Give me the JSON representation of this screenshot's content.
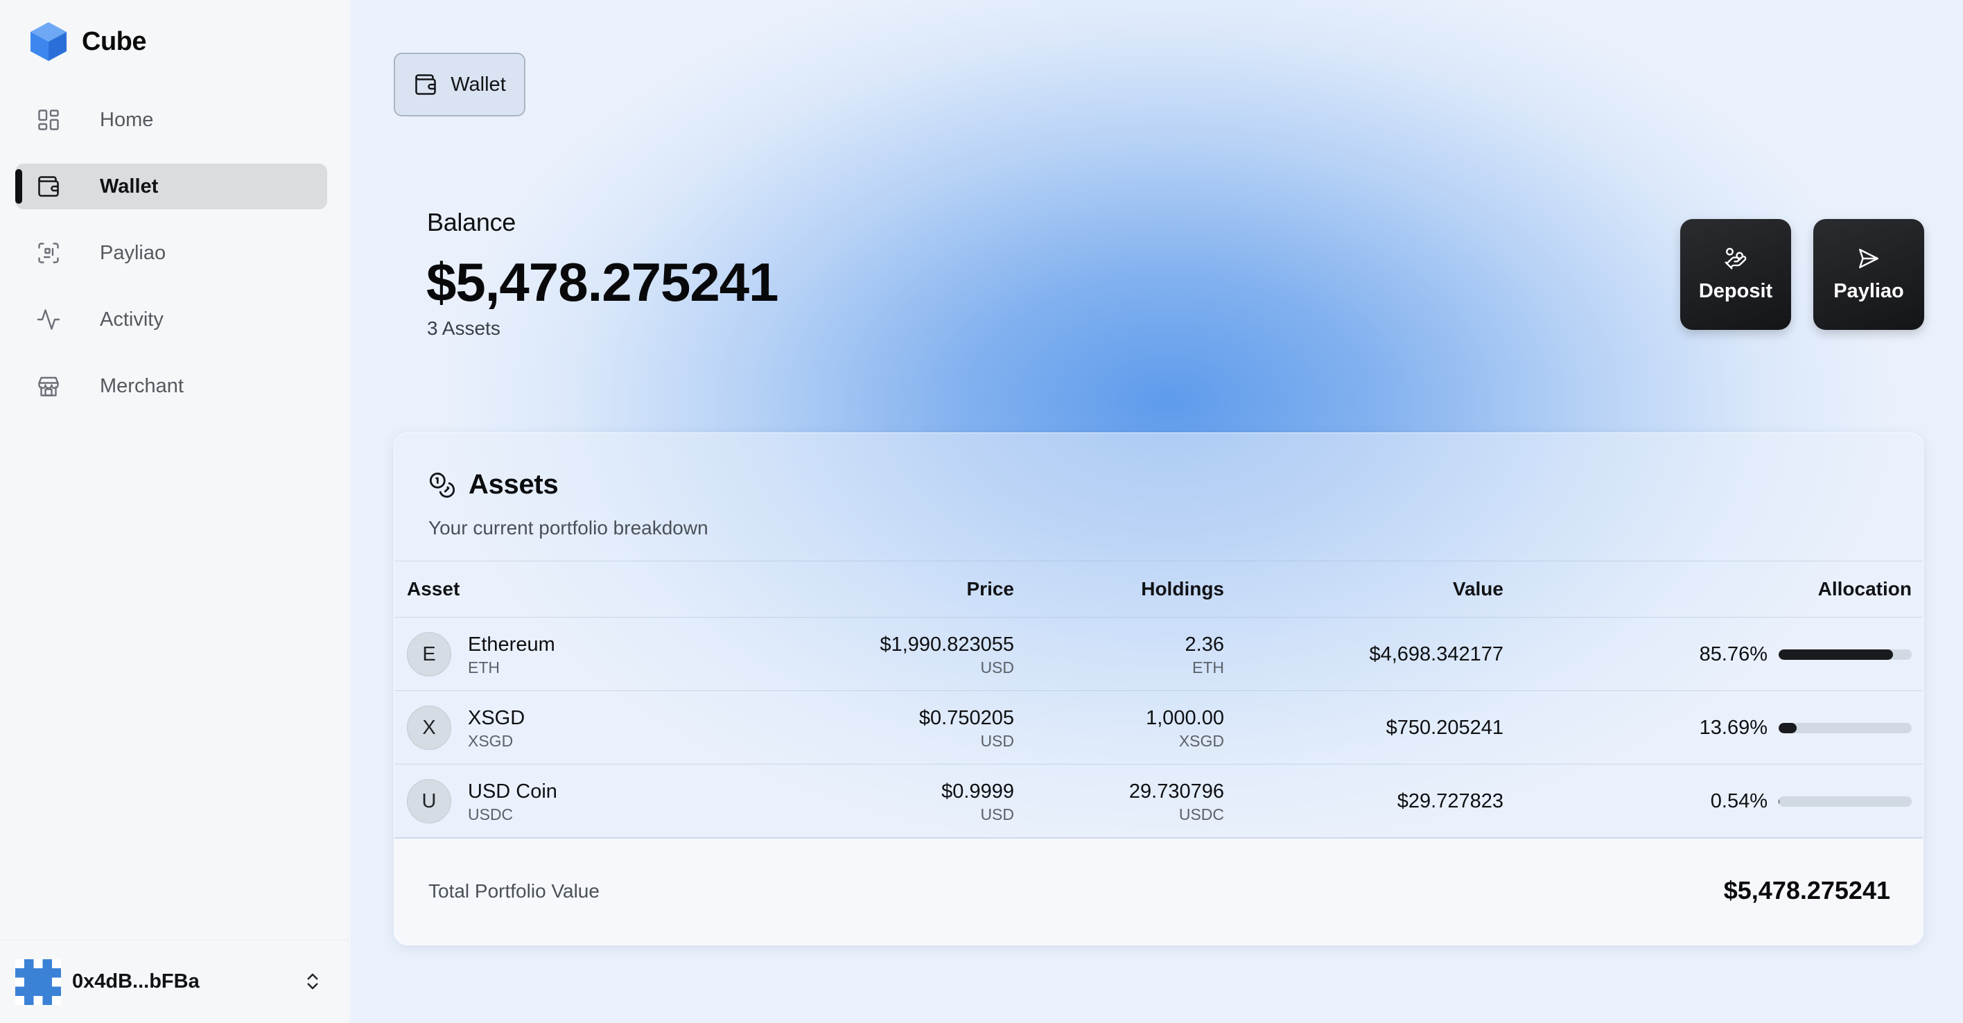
{
  "brand": {
    "name": "Cube",
    "logo_icon": "cube-logo-icon",
    "accent": "#3b82f6"
  },
  "sidebar": {
    "items": [
      {
        "label": "Home",
        "icon": "grid-icon",
        "active": false
      },
      {
        "label": "Wallet",
        "icon": "wallet-icon",
        "active": true
      },
      {
        "label": "Payliao",
        "icon": "scan-icon",
        "active": false
      },
      {
        "label": "Activity",
        "icon": "activity-icon",
        "active": false
      },
      {
        "label": "Merchant",
        "icon": "store-icon",
        "active": false
      }
    ],
    "account": {
      "address": "0x4dB...bFBa",
      "toggle_icon": "chevrons-up-down-icon"
    }
  },
  "header": {
    "tab_label": "Wallet"
  },
  "balance": {
    "label": "Balance",
    "amount": "$5,478.275241",
    "assets_count": "3 Assets"
  },
  "actions": {
    "deposit_label": "Deposit",
    "payliao_label": "Payliao"
  },
  "assets": {
    "title": "Assets",
    "description": "Your current portfolio breakdown",
    "columns": {
      "asset": "Asset",
      "price": "Price",
      "holdings": "Holdings",
      "value": "Value",
      "allocation": "Allocation"
    },
    "rows": [
      {
        "initial": "E",
        "name": "Ethereum",
        "symbol": "ETH",
        "price": "$1,990.823055",
        "price_unit": "USD",
        "holdings": "2.36",
        "holdings_unit": "ETH",
        "value": "$4,698.342177",
        "allocation": "85.76%",
        "allocation_fraction": 0.8576
      },
      {
        "initial": "X",
        "name": "XSGD",
        "symbol": "XSGD",
        "price": "$0.750205",
        "price_unit": "USD",
        "holdings": "1,000.00",
        "holdings_unit": "XSGD",
        "value": "$750.205241",
        "allocation": "13.69%",
        "allocation_fraction": 0.1369
      },
      {
        "initial": "U",
        "name": "USD Coin",
        "symbol": "USDC",
        "price": "$0.9999",
        "price_unit": "USD",
        "holdings": "29.730796",
        "holdings_unit": "USDC",
        "value": "$29.727823",
        "allocation": "0.54%",
        "allocation_fraction": 0.0054
      }
    ],
    "footer": {
      "label": "Total Portfolio Value",
      "value": "$5,478.275241"
    }
  }
}
